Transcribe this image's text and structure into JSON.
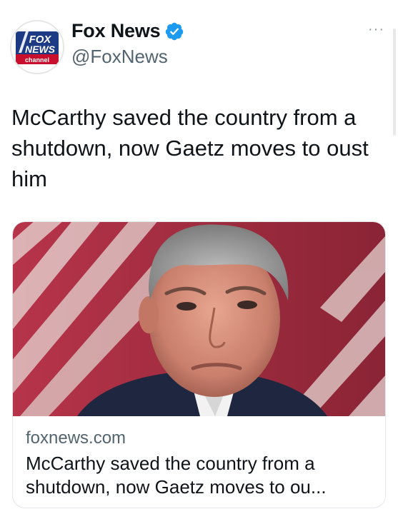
{
  "account": {
    "display_name": "Fox News",
    "handle": "@FoxNews",
    "verified": true,
    "avatar_logo": {
      "line1": "FOX",
      "line2": "NEWS",
      "line3": "channel"
    }
  },
  "more_label": "···",
  "tweet": {
    "text": "McCarthy saved the country from a shutdown, now Gaetz moves to oust him"
  },
  "link_card": {
    "domain": "foxnews.com",
    "title": "McCarthy saved the country from a\nshutdown, now Gaetz moves to ou..."
  },
  "colors": {
    "verified_blue": "#1d9bf0",
    "fox_blue": "#1d3a84",
    "fox_red": "#c8102e",
    "secondary_text": "#536471"
  }
}
